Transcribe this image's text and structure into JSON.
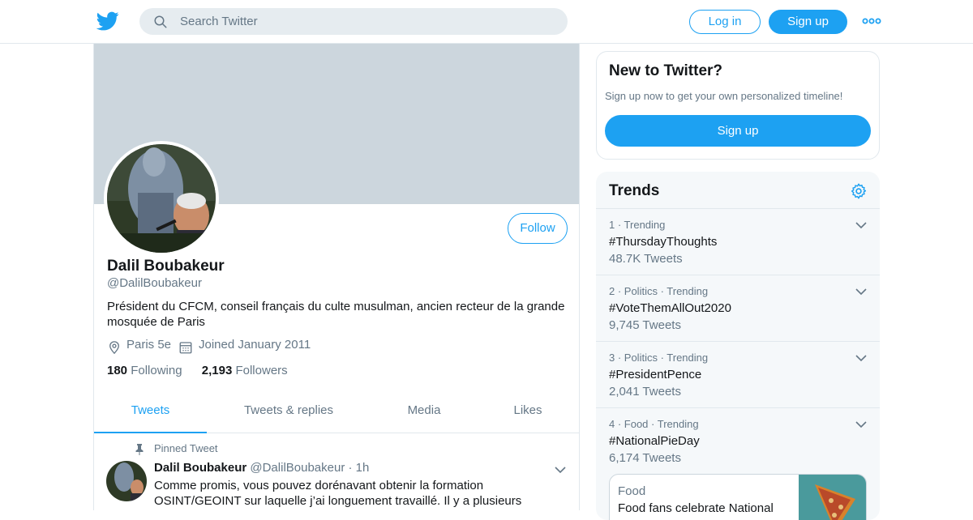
{
  "header": {
    "search_placeholder": "Search Twitter",
    "login_label": "Log in",
    "signup_label": "Sign up"
  },
  "profile": {
    "follow_label": "Follow",
    "display_name": "Dalil Boubakeur",
    "handle": "@DalilBoubakeur",
    "bio": "Président du CFCM, conseil français du culte musulman, ancien recteur de la grande mosquée de Paris",
    "location": "Paris 5e",
    "joined": "Joined January 2011",
    "following_count": "180",
    "following_label": "Following",
    "followers_count": "2,193",
    "followers_label": "Followers"
  },
  "tabs": [
    {
      "label": "Tweets"
    },
    {
      "label": "Tweets & replies"
    },
    {
      "label": "Media"
    },
    {
      "label": "Likes"
    }
  ],
  "pinned_tweet": {
    "pinned_label": "Pinned Tweet",
    "name": "Dalil Boubakeur",
    "handle": "@DalilBoubakeur",
    "time": "· 1h",
    "text": "Comme promis, vous pouvez dorénavant obtenir la formation OSINT/GEOINT sur laquelle j’ai longuement travaillé. Il y a plusieurs"
  },
  "new_to_twitter": {
    "title": "New to Twitter?",
    "subtitle": "Sign up now to get your own personalized timeline!",
    "button": "Sign up"
  },
  "trends": {
    "title": "Trends",
    "items": [
      {
        "meta": "1 · Trending",
        "name": "#ThursdayThoughts",
        "count": "48.7K Tweets"
      },
      {
        "meta": "2 · Politics · Trending",
        "name": "#VoteThemAllOut2020",
        "count": "9,745 Tweets"
      },
      {
        "meta": "3 · Politics · Trending",
        "name": "#PresidentPence",
        "count": "2,041 Tweets"
      },
      {
        "meta": "4 · Food · Trending",
        "name": "#NationalPieDay",
        "count": "6,174 Tweets"
      }
    ],
    "news": {
      "category": "Food",
      "headline": "Food fans celebrate National"
    }
  },
  "colors": {
    "accent": "#1da1f2",
    "banner": "#ccd6dd",
    "secondary_text": "#657786",
    "panel": "#f5f8fa"
  }
}
